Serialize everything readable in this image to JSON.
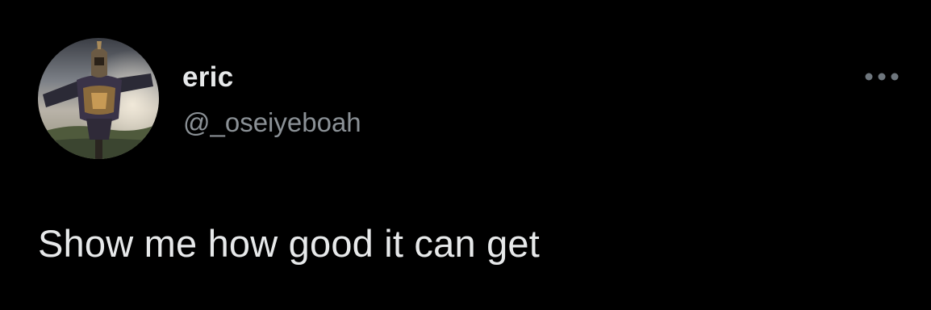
{
  "tweet": {
    "author": {
      "display_name": "eric",
      "handle": "@_oseiyeboah",
      "avatar_icon": "armor-scarecrow-avatar"
    },
    "more_icon": "more-horizontal-icon",
    "text": "Show me how good it can get"
  },
  "colors": {
    "background": "#000000",
    "primary_text": "#e7e9ea",
    "secondary_text": "#8b9196"
  }
}
